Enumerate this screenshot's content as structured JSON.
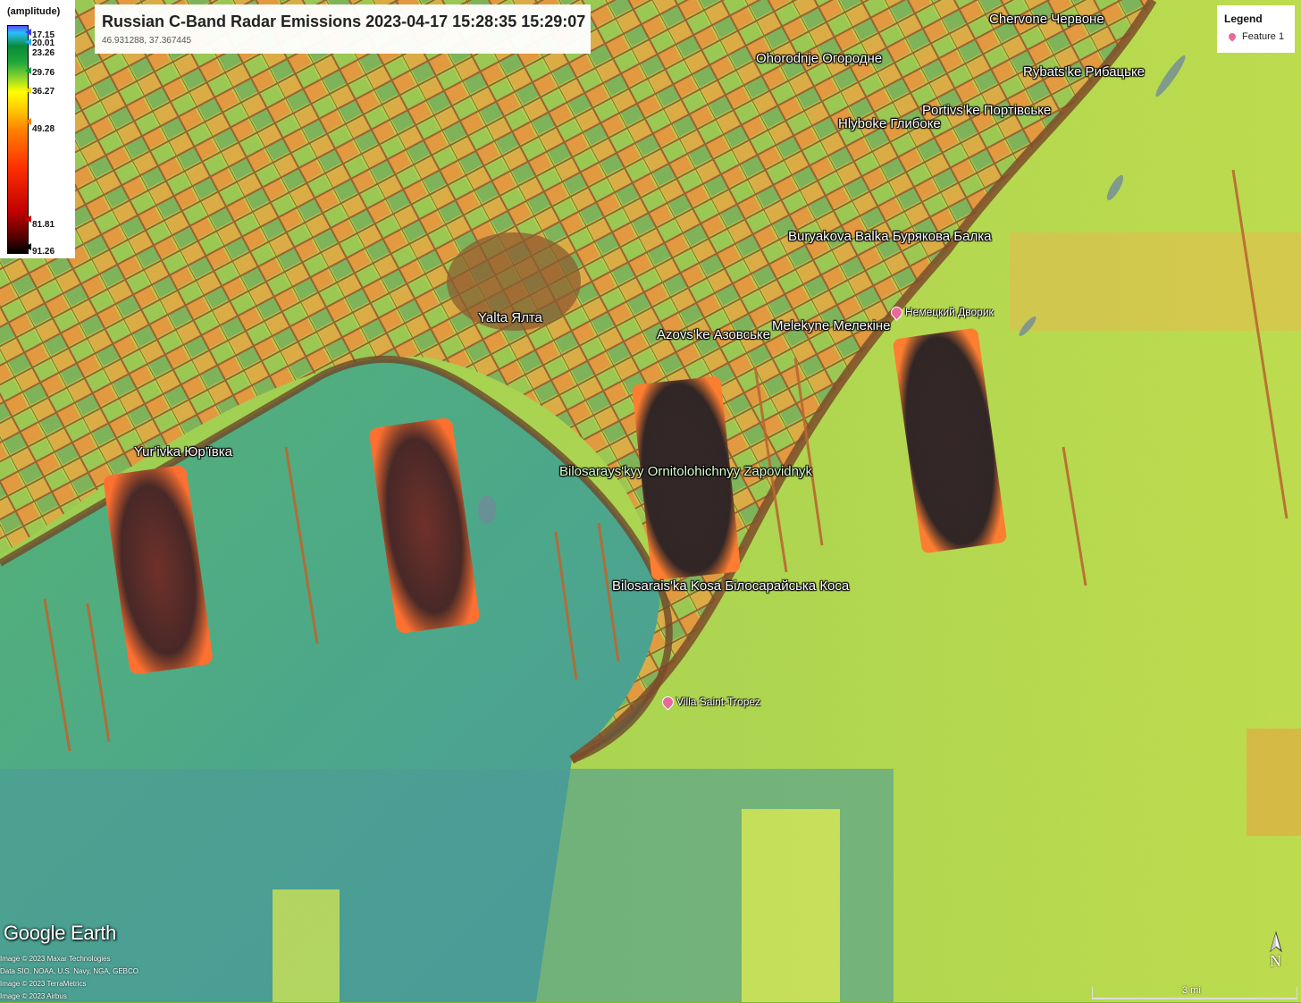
{
  "title": "Russian C-Band Radar Emissions 2023-04-17 15:28:35 15:29:07",
  "coordinates": "46.931288, 37.367445",
  "scale_legend": {
    "label": "(amplitude)",
    "ticks": [
      "17.15",
      "20.01",
      "23.26",
      "29.76",
      "36.27",
      "49.28",
      "81.81",
      "91.26"
    ]
  },
  "legend": {
    "heading": "Legend",
    "feature": "Feature 1",
    "pin_color": "#e86a9a"
  },
  "places": [
    "Chervone Червоне",
    "Ohorodnje Огородне",
    "Rybats'ke Рибацьке",
    "Portivs'ke Портівське",
    "Hlyboke Глибоке",
    "Buryakova Balka Бурякова Балка",
    "Yalta Ялта",
    "Azovs'ke Азовське",
    "Melekyne Мелекіне",
    "Yur'ivka Юр'ївка",
    "Bilosarays'kyy Ornitolohichnyy Zapovidnyk",
    "Bilosarais'ka Kosa Білосарайська Коса"
  ],
  "pois": [
    "Немецкий Дворик",
    "Villa Saint-Tropez"
  ],
  "logo": "Google Earth",
  "credits": [
    "Image © 2023 Maxar Technologies",
    "Data SIO, NOAA, U.S. Navy, NGA, GEBCO",
    "Image © 2023 TerraMetrics",
    "Image © 2023 Airbus"
  ],
  "north_label": "N",
  "scalebar_label": "3 mi",
  "colors": {
    "land": "#c8a030",
    "sea_green": "#3aa860",
    "sea_blue": "#2f8c88",
    "open_sea": "#9ad030",
    "radar_box": "#1a0605"
  }
}
